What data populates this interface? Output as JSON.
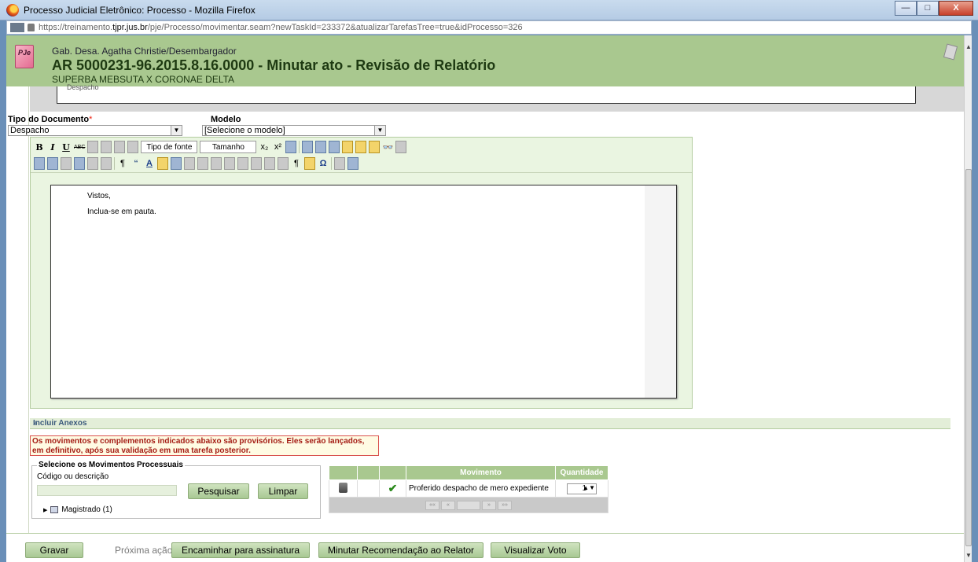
{
  "window": {
    "title": "Processo Judicial Eletrônico: Processo - Mozilla Firefox",
    "url_prefix": "https://treinamento.",
    "url_domain": "tjpr.jus.br",
    "url_suffix": "/pje/Processo/movimentar.seam?newTaskId=233372&atualizarTarefasTree=true&idProcesso=326",
    "buttons": {
      "minimize": "—",
      "maximize": "□",
      "close": "X"
    }
  },
  "header": {
    "logo_text": "PJe",
    "gabinete": "Gab. Desa. Agatha Christie/Desembargador",
    "process_title": "AR 5000231-96.2015.8.16.0000 - Minutar ato - Revisão de Relatório",
    "parties": "SUPERBA MEBSUTA X CORONAE DELTA"
  },
  "previous_box_text": "Despacho",
  "form": {
    "tipo_label": "Tipo do Documento",
    "tipo_required_mark": "*",
    "tipo_value": "Despacho",
    "modelo_label": "Modelo",
    "modelo_value": "[Selecione o modelo]"
  },
  "toolbar": {
    "bold": "B",
    "italic": "I",
    "underline": "U",
    "strike": "ABC",
    "font_combo": "Tipo de fonte",
    "size_combo": "Tamanho",
    "subscript": "x₂",
    "superscript": "x²",
    "quote": "“",
    "font_color": "A",
    "find": "👓",
    "omega": "Ω",
    "pilcrow": "¶"
  },
  "document": {
    "line1": "Vistos,",
    "line2": "Inclua-se em pauta."
  },
  "anexos": {
    "label": "Incluir Anexos",
    "expand": "»"
  },
  "warning": "Os movimentos e complementos indicados abaixo são provisórios. Eles serão lançados, em definitivo, após sua validação em uma tarefa posterior.",
  "movimentos": {
    "legend": "Selecione os Movimentos Processuais",
    "search_label": "Código ou descrição",
    "search_placeholder": "",
    "search_button": "Pesquisar",
    "clear_button": "Limpar",
    "tree_item": "Magistrado (1)"
  },
  "table": {
    "headers": [
      "",
      "",
      "",
      "Movimento",
      "Quantidade"
    ],
    "rows": [
      {
        "movimento": "Proferido despacho de mero expediente",
        "quantidade": "1"
      }
    ],
    "pager": [
      "««",
      "«",
      "",
      "»",
      "»»"
    ]
  },
  "actions": {
    "save": "Gravar",
    "next_label": "Próxima ação:",
    "next1": "Encaminhar para assinatura",
    "next2": "Minutar Recomendação ao Relator",
    "next3": "Visualizar Voto"
  },
  "colors": {
    "header_green": "#a9c88f",
    "editor_bg": "#eaf5e1",
    "button_green": "#a8c893",
    "warning_red": "#d9534f"
  }
}
